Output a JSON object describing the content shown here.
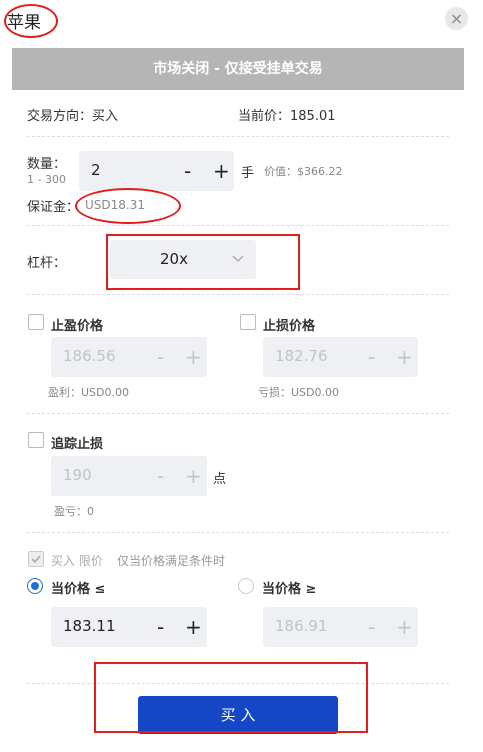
{
  "header": {
    "title": "苹果",
    "close_icon": "×"
  },
  "banner": {
    "text": "市场关闭 - 仅接受挂单交易"
  },
  "trade": {
    "direction_label": "交易方向：",
    "direction_value": "买入",
    "price_label": "当前价：",
    "price_value": "185.01"
  },
  "quantity": {
    "label": "数量：",
    "range": "1 - 300",
    "value": "2",
    "minus": "-",
    "plus": "+",
    "unit": "手",
    "worth_label": "价值：",
    "worth_value": "$366.22",
    "margin_label": "保证金：",
    "margin_value": "USD18.31"
  },
  "leverage": {
    "label": "杠杆：",
    "value": "20x"
  },
  "take_profit": {
    "label": "止盈价格",
    "value": "186.56",
    "minus": "-",
    "plus": "+",
    "sub_label": "盈利：",
    "sub_value": "USD0.00"
  },
  "stop_loss": {
    "label": "止损价格",
    "value": "182.76",
    "minus": "-",
    "plus": "+",
    "sub_label": "亏损：",
    "sub_value": "USD0.00"
  },
  "trailing": {
    "label": "追踪止损",
    "value": "190",
    "minus": "-",
    "plus": "+",
    "unit": "点",
    "sub_label": "盈亏：",
    "sub_value": "0"
  },
  "limit": {
    "label": "买入 限价",
    "hint": "仅当价格满足条件时",
    "radio1_label": "当价格 ≤",
    "radio1_value": "183.11",
    "radio2_label": "当价格 ≥",
    "radio2_value": "186.91",
    "minus": "-",
    "plus": "+"
  },
  "submit": {
    "label": "买 入"
  },
  "colors": {
    "accent": "#1446c6",
    "radio": "#1f6fd2",
    "annotation": "#e0201c",
    "banner": "#b5b5b5"
  }
}
